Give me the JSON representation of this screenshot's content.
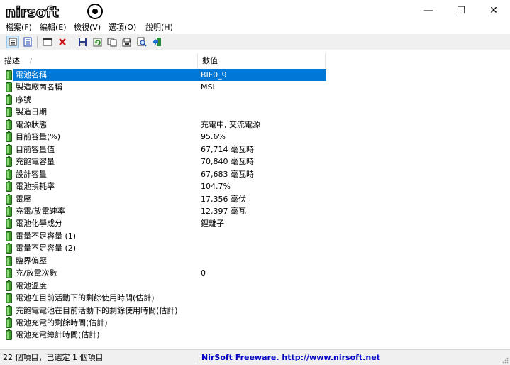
{
  "window": {
    "logo_text": "nirsoft",
    "minimize": "—",
    "maximize": "☐",
    "close": "✕"
  },
  "menu": [
    "檔案(F)",
    "編輯(E)",
    "檢視(V)",
    "選項(O)",
    "說明(H)"
  ],
  "toolbar_icons": [
    "details-view-icon",
    "report-view-icon",
    "properties-icon",
    "delete-icon",
    "save-icon",
    "refresh-icon",
    "copy-icon",
    "html-report-icon",
    "find-icon",
    "exit-icon"
  ],
  "list": {
    "columns": [
      "描述",
      "數值"
    ],
    "sort_indicator": "/",
    "rows": [
      {
        "label": "電池名稱",
        "value": "BIF0_9",
        "selected": true
      },
      {
        "label": "製造廠商名稱",
        "value": "MSI"
      },
      {
        "label": "序號",
        "value": ""
      },
      {
        "label": "製造日期",
        "value": ""
      },
      {
        "label": "電源狀態",
        "value": "充電中, 交流電源"
      },
      {
        "label": "目前容量(%)",
        "value": "95.6%"
      },
      {
        "label": "目前容量值",
        "value": "67,714 毫瓦時"
      },
      {
        "label": "充飽電容量",
        "value": "70,840 毫瓦時"
      },
      {
        "label": "設計容量",
        "value": "67,683 毫瓦時"
      },
      {
        "label": "電池損耗率",
        "value": "104.7%"
      },
      {
        "label": "電壓",
        "value": "17,356 毫伏"
      },
      {
        "label": "充電/放電速率",
        "value": "12,397 毫瓦"
      },
      {
        "label": "電池化學成分",
        "value": "鋰離子"
      },
      {
        "label": "電量不足容量 (1)",
        "value": ""
      },
      {
        "label": "電量不足容量 (2)",
        "value": ""
      },
      {
        "label": "臨界偏壓",
        "value": ""
      },
      {
        "label": "充/放電次數",
        "value": "0"
      },
      {
        "label": "電池溫度",
        "value": ""
      },
      {
        "label": "電池在目前活動下的剩餘使用時間(估計)",
        "value": ""
      },
      {
        "label": "充飽電電池在目前活動下的剩餘使用時間(估計)",
        "value": ""
      },
      {
        "label": "電池充電的剩餘時間(估計)",
        "value": ""
      },
      {
        "label": "電池充電總計時間(估計)",
        "value": ""
      }
    ]
  },
  "status": {
    "items": "22 個項目，已選定 1 個項目",
    "credit": "NirSoft Freeware.  http://www.nirsoft.net"
  },
  "colors": {
    "selection": "#0078d7",
    "battery_green": "#3a9a2a",
    "credit_link": "#0000c0"
  }
}
